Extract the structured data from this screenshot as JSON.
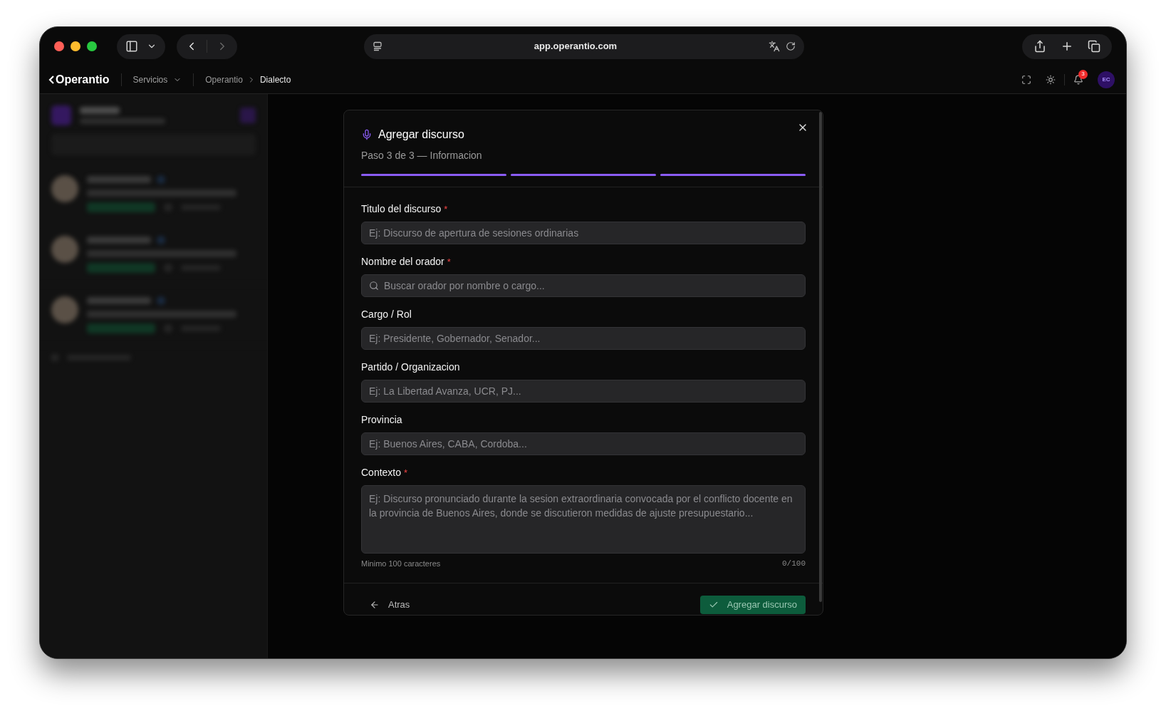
{
  "browser": {
    "url": "app.operantio.com"
  },
  "app_bar": {
    "logo": "Operantio",
    "menu": "Servicios",
    "breadcrumb": [
      {
        "label": "Operantio",
        "current": false
      },
      {
        "label": "Dialecto",
        "current": true
      }
    ],
    "notification_count": "3",
    "avatar_initials": "EC"
  },
  "dialog": {
    "title": "Agregar discurso",
    "step_text": "Paso 3 de 3 — Informacion",
    "steps": [
      {
        "complete": true
      },
      {
        "complete": true
      },
      {
        "complete": true
      }
    ],
    "fields": [
      {
        "kind": "text",
        "label": "Titulo del discurso",
        "required": true,
        "placeholder": "Ej: Discurso de apertura de sesiones ordinarias"
      },
      {
        "kind": "search",
        "label": "Nombre del orador",
        "required": true,
        "placeholder": "Buscar orador por nombre o cargo..."
      },
      {
        "kind": "text",
        "label": "Cargo / Rol",
        "required": false,
        "placeholder": "Ej: Presidente, Gobernador, Senador..."
      },
      {
        "kind": "text",
        "label": "Partido / Organizacion",
        "required": false,
        "placeholder": "Ej: La Libertad Avanza, UCR, PJ..."
      },
      {
        "kind": "text",
        "label": "Provincia",
        "required": false,
        "placeholder": "Ej: Buenos Aires, CABA, Cordoba..."
      },
      {
        "kind": "textarea",
        "label": "Contexto",
        "required": true,
        "placeholder": "Ej: Discurso pronunciado durante la sesion extraordinaria convocada por el conflicto docente en la provincia de Buenos Aires, donde se discutieron medidas de ajuste presupuestario..."
      }
    ],
    "required_mark": "*",
    "hint": "Minimo 100 caracteres",
    "counter": "0/100",
    "back_button": "Atras",
    "submit_button": "Agregar discurso"
  }
}
